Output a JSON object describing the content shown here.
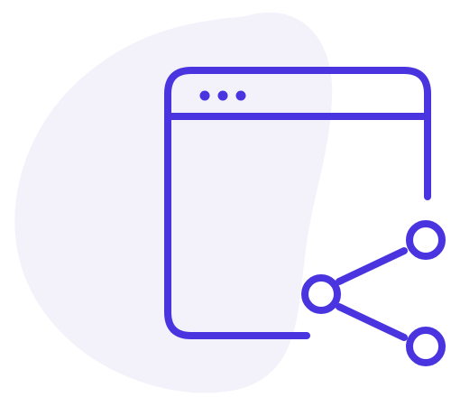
{
  "illustration": {
    "name": "browser-window-share",
    "colors": {
      "stroke": "#4A34E0",
      "blob": "#F3F2FB",
      "background": "#FFFFFF"
    },
    "icons": [
      "browser-window-icon",
      "share-icon"
    ],
    "window_dots_count": 3,
    "share_nodes_count": 3
  }
}
